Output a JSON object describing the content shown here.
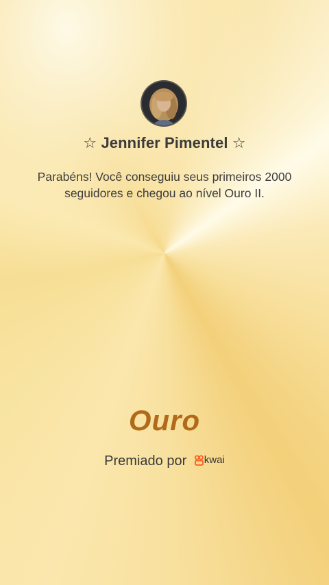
{
  "user": {
    "name": "☆ Jennifer Pimentel ☆"
  },
  "message": "Parabéns! Você conseguiu seus primeiros 2000 seguidores e chegou ao nível Ouro II.",
  "level": "Ouro",
  "awarded_by": {
    "label": "Premiado por",
    "brand": "kwai",
    "brand_color": "#ff5a1f"
  },
  "colors": {
    "background": "#f8e1a0",
    "level_text": "#b06a18"
  },
  "icons": [
    "avatar-photo",
    "kwai-logo-icon"
  ]
}
